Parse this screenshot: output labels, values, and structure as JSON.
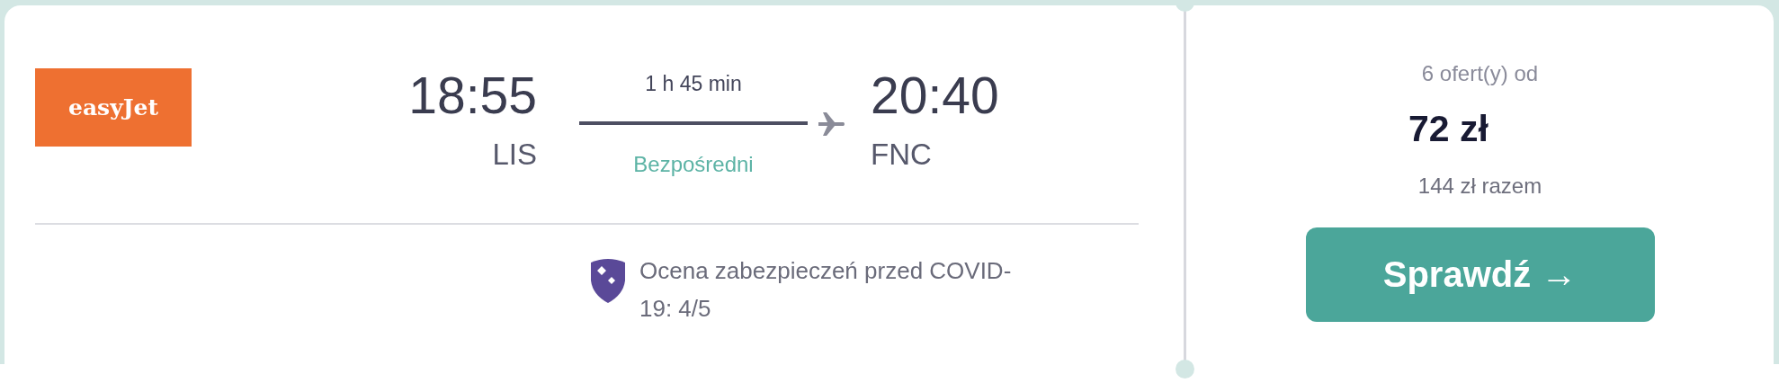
{
  "airline": {
    "logo_text": "easyJet"
  },
  "departure": {
    "time": "18:55",
    "airport": "LIS"
  },
  "duration": "1 h 45 min",
  "stops": "Bezpośredni",
  "arrival": {
    "time": "20:40",
    "airport": "FNC"
  },
  "safety_rating": "Ocena zabezpieczeń przed COVID-19: 4/5",
  "offers": {
    "count_label": "6 ofert(y) od",
    "price": "72 zł",
    "total": "144 zł razem"
  },
  "button": "Sprawdź →"
}
